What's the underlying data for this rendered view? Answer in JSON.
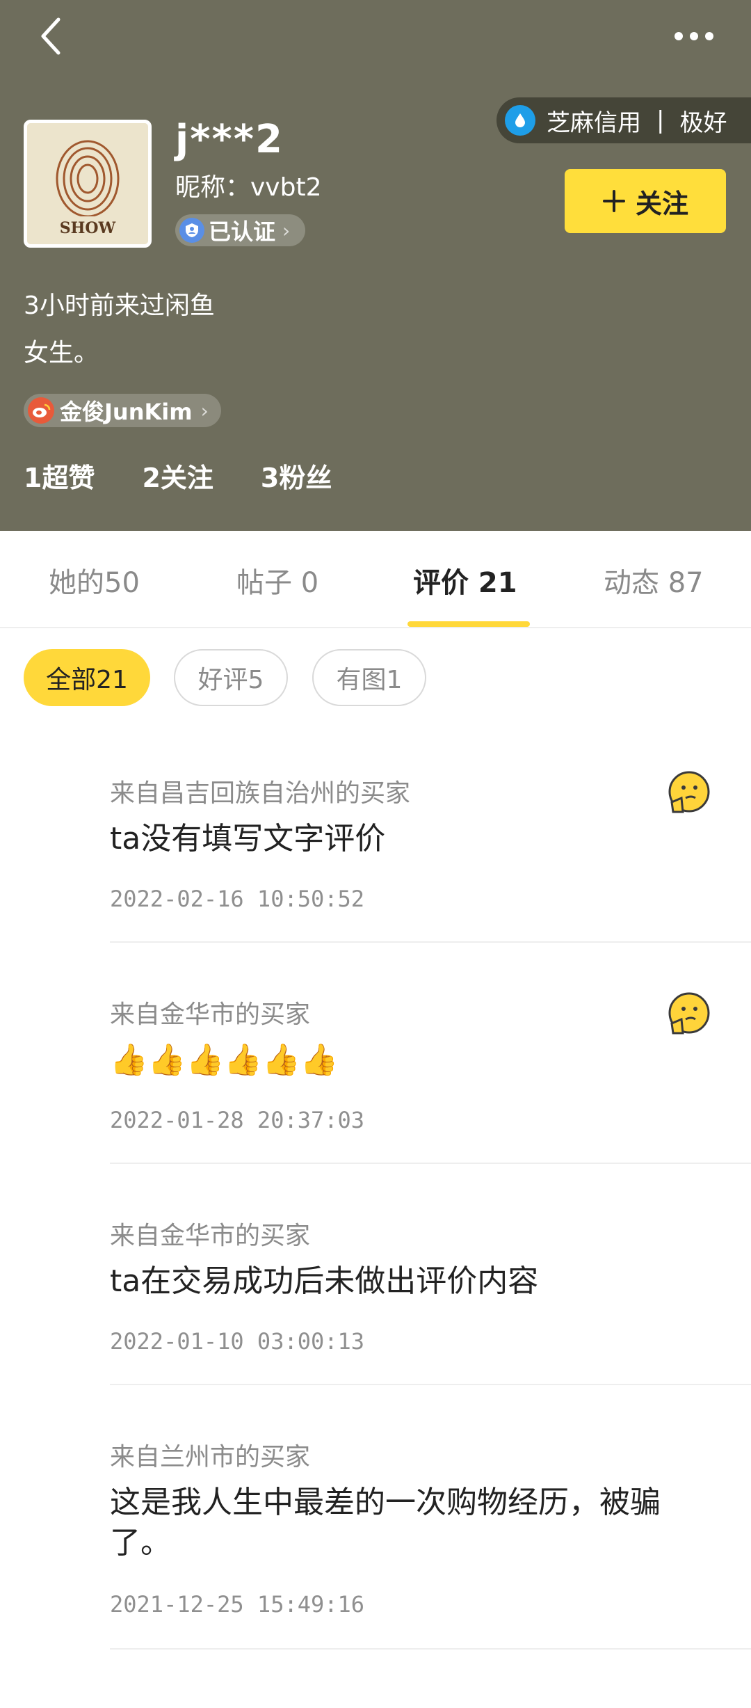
{
  "header": {
    "back_icon": "chevron-left-icon",
    "more_icon": "more-dots-icon",
    "username": "j***2",
    "nickname": "昵称：vvbt2",
    "verified_label": "已认证",
    "credit": {
      "label": "芝麻信用",
      "separator": "|",
      "level": "极好"
    },
    "follow_label": "关注",
    "last_seen": "3小时前来过闲鱼",
    "bio": "女生。",
    "weibo_name": "金俊JunKim",
    "stats": [
      {
        "label": "1超赞"
      },
      {
        "label": "2关注"
      },
      {
        "label": "3粉丝"
      }
    ]
  },
  "tabs": [
    {
      "label": "她的50"
    },
    {
      "label": "帖子 0"
    },
    {
      "label": "评价 21",
      "active": true
    },
    {
      "label": "动态 87"
    }
  ],
  "filters": [
    {
      "label": "全部21",
      "active": true
    },
    {
      "label": "好评5"
    },
    {
      "label": "有图1"
    }
  ],
  "reviews": [
    {
      "from": "来自昌吉回族自治州的买家",
      "content": "ta没有填写文字评价",
      "date": "2022-02-16 10:50:52",
      "badge": "thinking-face-icon"
    },
    {
      "from": "来自金华市的买家",
      "content": "👍👍👍👍👍👍",
      "date": "2022-01-28 20:37:03",
      "badge": "thinking-face-icon"
    },
    {
      "from": "来自金华市的买家",
      "content": "ta在交易成功后未做出评价内容",
      "date": "2022-01-10 03:00:13"
    },
    {
      "from": "来自兰州市的买家",
      "content": "这是我人生中最差的一次购物经历，被骗了。",
      "date": "2021-12-25 15:49:16"
    }
  ],
  "colors": {
    "header_bg": "#6e6d5c",
    "accent_yellow": "#ffd83a",
    "credit_blue": "#1e9ee8"
  }
}
